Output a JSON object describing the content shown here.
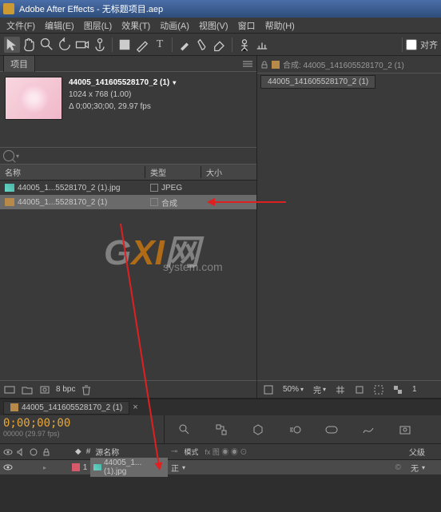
{
  "titlebar": {
    "title": "Adobe After Effects - 无标题项目.aep"
  },
  "menu": {
    "file": "文件(F)",
    "edit": "编辑(E)",
    "layer": "图层(L)",
    "effect": "效果(T)",
    "animation": "动画(A)",
    "view": "视图(V)",
    "window": "窗口",
    "help": "帮助(H)"
  },
  "toolbar": {
    "align_label": "对齐"
  },
  "project": {
    "tab": "项目",
    "item_name": "44005_141605528170_2 (1)",
    "item_dims": "1024 x 768 (1.00)",
    "item_delta": "Δ 0;00;30;00, 29.97 fps",
    "columns": {
      "name": "名称",
      "type": "类型",
      "size": "大小"
    },
    "rows": [
      {
        "name": "44005_1...5528170_2 (1).jpg",
        "type": "JPEG"
      },
      {
        "name": "44005_1...5528170_2 (1)",
        "type": "合成"
      }
    ],
    "bpc": "8 bpc"
  },
  "composition": {
    "header": "合成: 44005_141605528170_2 (1)",
    "tab": "44005_141605528170_2 (1)",
    "zoom": "50%",
    "view_mode": "完",
    "camera": "1"
  },
  "timeline": {
    "tab": "44005_141605528170_2 (1)",
    "timecode": "0;00;00;00",
    "subtc": "00000 (29.97 fps)",
    "cols": {
      "source": "源名称",
      "mode": "模式",
      "parent": "父级",
      "none": "无"
    },
    "layer": {
      "index": "1",
      "name": "44005_1... (1).jpg",
      "mode": "正",
      "parent": "无"
    }
  }
}
